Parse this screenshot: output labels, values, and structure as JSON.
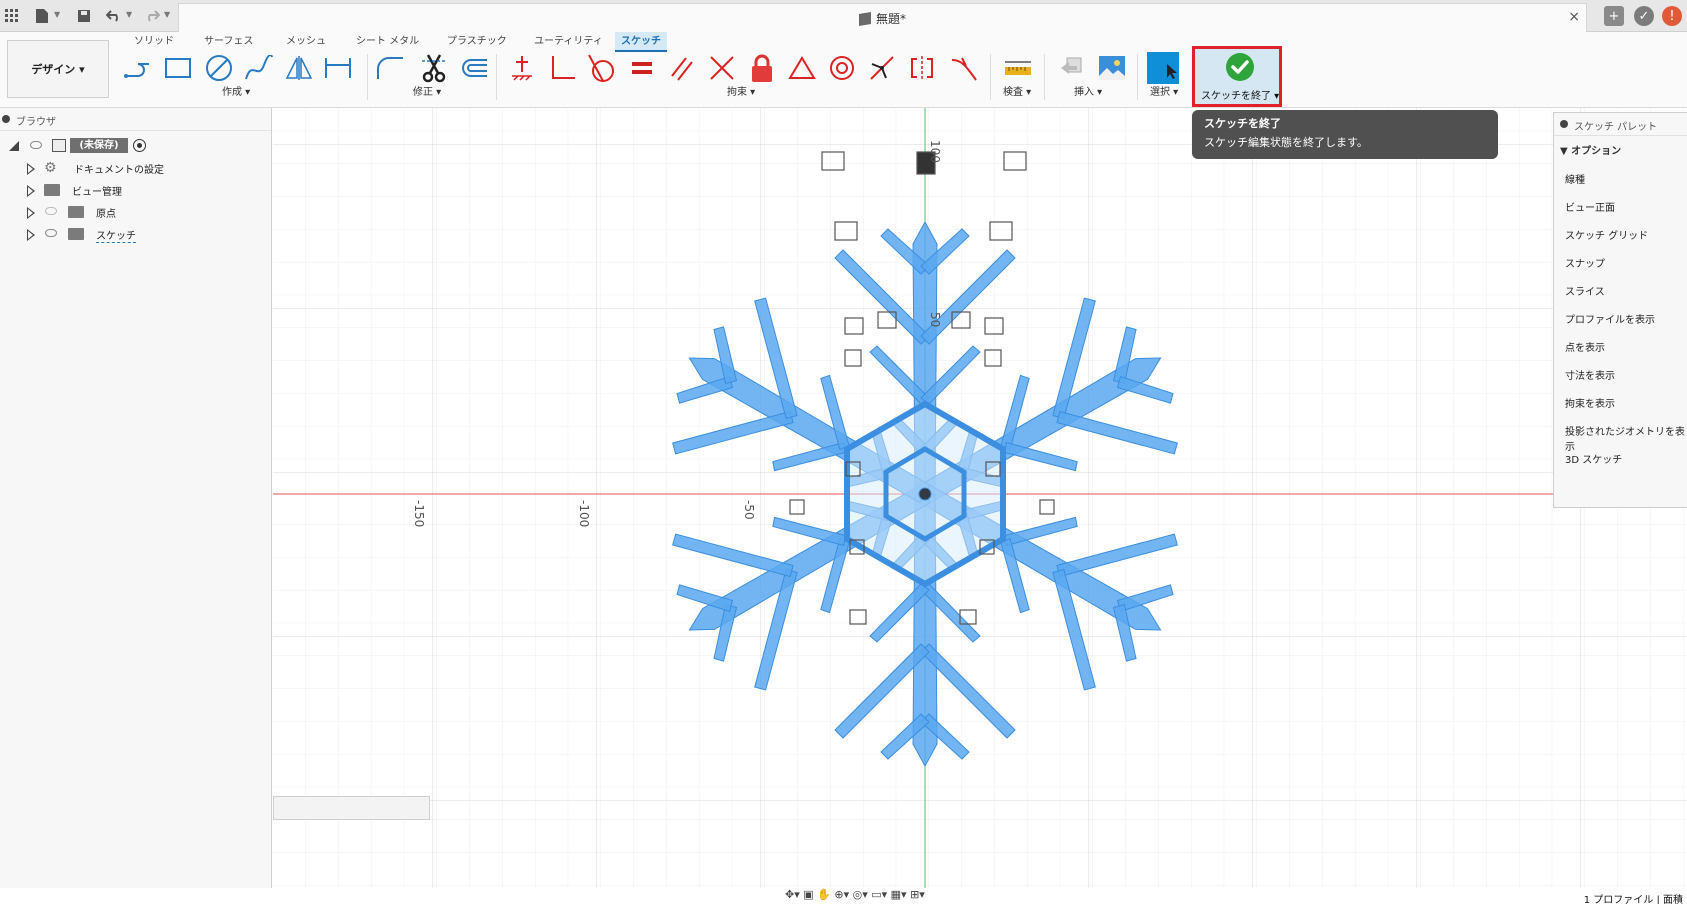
{
  "window": {
    "document_title": "無題*",
    "close_glyph": "×"
  },
  "ribbon": {
    "workspace_label": "デザイン ▾",
    "tabs": [
      "ソリッド",
      "サーフェス",
      "メッシュ",
      "シート メタル",
      "プラスチック",
      "ユーティリティ",
      "スケッチ"
    ],
    "active_tab": "スケッチ",
    "groups": {
      "create": "作成 ▾",
      "modify": "修正 ▾",
      "constraints": "拘束 ▾",
      "inspect": "検査 ▾",
      "insert": "挿入 ▾",
      "select": "選択 ▾"
    },
    "finish_sketch_label": "スケッチを終了 ▾"
  },
  "tooltip": {
    "title": "スケッチを終了",
    "description": "スケッチ編集状態を終了します。"
  },
  "browser": {
    "title": "ブラウザ",
    "root_label": "(未保存)",
    "items": [
      {
        "label": "ドキュメントの設定"
      },
      {
        "label": "ビュー管理"
      },
      {
        "label": "原点"
      },
      {
        "label": "スケッチ"
      }
    ]
  },
  "palette": {
    "title": "スケッチ パレット",
    "section": "▼ オプション",
    "items": [
      "線種",
      "ビュー正面",
      "スケッチ グリッド",
      "スナップ",
      "スライス",
      "プロファイルを表示",
      "点を表示",
      "寸法を表示",
      "拘束を表示",
      "投影されたジオメトリを表示",
      "3D スケッチ"
    ]
  },
  "canvas": {
    "axis_labels": {
      "x_neg150": "-150",
      "x_neg100": "-100",
      "x_neg50": "-50",
      "y_100": "100",
      "y_50": "50"
    }
  },
  "status": {
    "text": "1 プロファイル | 面積"
  },
  "colors": {
    "accent": "#1b6fb3",
    "highlight_border": "#e0202a",
    "snowflake_fill": "#5aa8f0",
    "x_axis": "#e05555",
    "y_axis": "#55c070"
  }
}
